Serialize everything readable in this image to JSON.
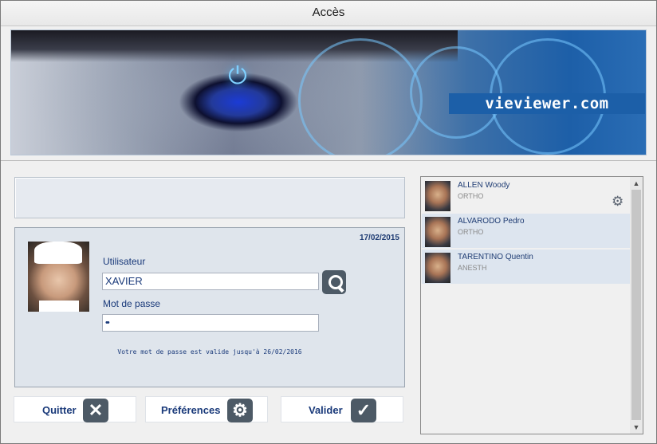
{
  "window": {
    "title": "Accès"
  },
  "banner": {
    "brand": "vieviewer.com",
    "icon": "power-icon"
  },
  "login": {
    "date": "17/02/2015",
    "user_label": "Utilisateur",
    "user_value": "XAVIER",
    "password_label": "Mot de passe",
    "password_value": "••",
    "validity_text": "Votre mot de passe est valide jusqu'à 26/02/2016"
  },
  "actions": {
    "quit_label": "Quitter",
    "prefs_label": "Préférences",
    "validate_label": "Valider"
  },
  "users": [
    {
      "name": "ALLEN Woody",
      "role": "ORTHO",
      "selected": false
    },
    {
      "name": "ALVARODO Pedro",
      "role": "ORTHO",
      "selected": true
    },
    {
      "name": "TARENTINO Quentin",
      "role": "ANESTH",
      "selected": true
    }
  ],
  "colors": {
    "accent": "#1f3c73",
    "brand_bg": "#1c5fa8",
    "icon_bg": "#4d5a66"
  }
}
